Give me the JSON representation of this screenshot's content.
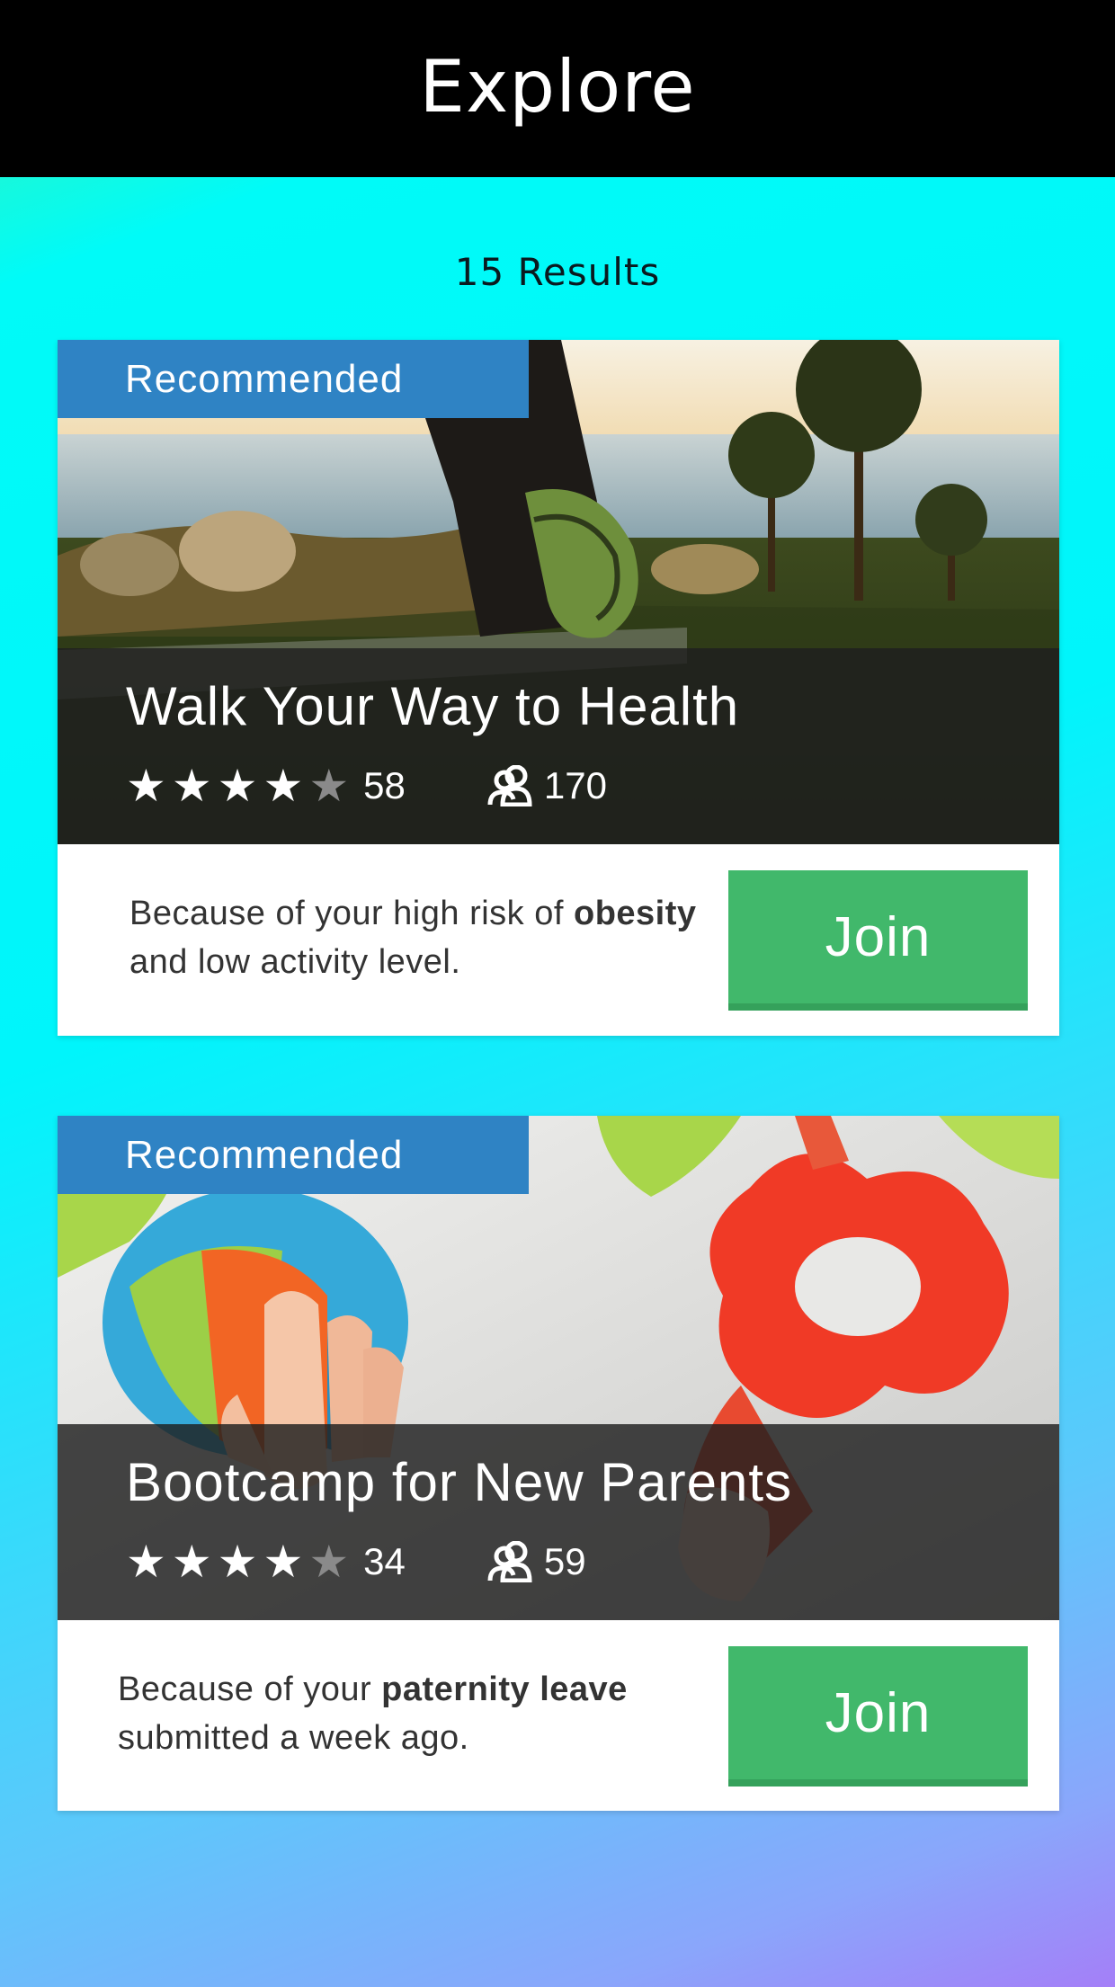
{
  "header": {
    "title": "Explore"
  },
  "results_label": "15 Results",
  "cards": [
    {
      "badge": "Recommended",
      "title": "Walk Your Way to Health",
      "rating": 4,
      "rating_max": 5,
      "rating_count": "58",
      "members": "170",
      "reason_pre": "Because of your high risk of ",
      "reason_bold": "obesity",
      "reason_post": " and low activity level.",
      "join_label": "Join"
    },
    {
      "badge": "Recommended",
      "title": "Bootcamp for New Parents",
      "rating": 4,
      "rating_max": 5,
      "rating_count": "34",
      "members": "59",
      "reason_pre": "Because of your ",
      "reason_bold": "paternity leave",
      "reason_post": " submitted a week ago.",
      "join_label": "Join"
    }
  ],
  "colors": {
    "header_bg": "#000000",
    "badge_bg": "#2f83c4",
    "join_bg": "#41b86b"
  }
}
